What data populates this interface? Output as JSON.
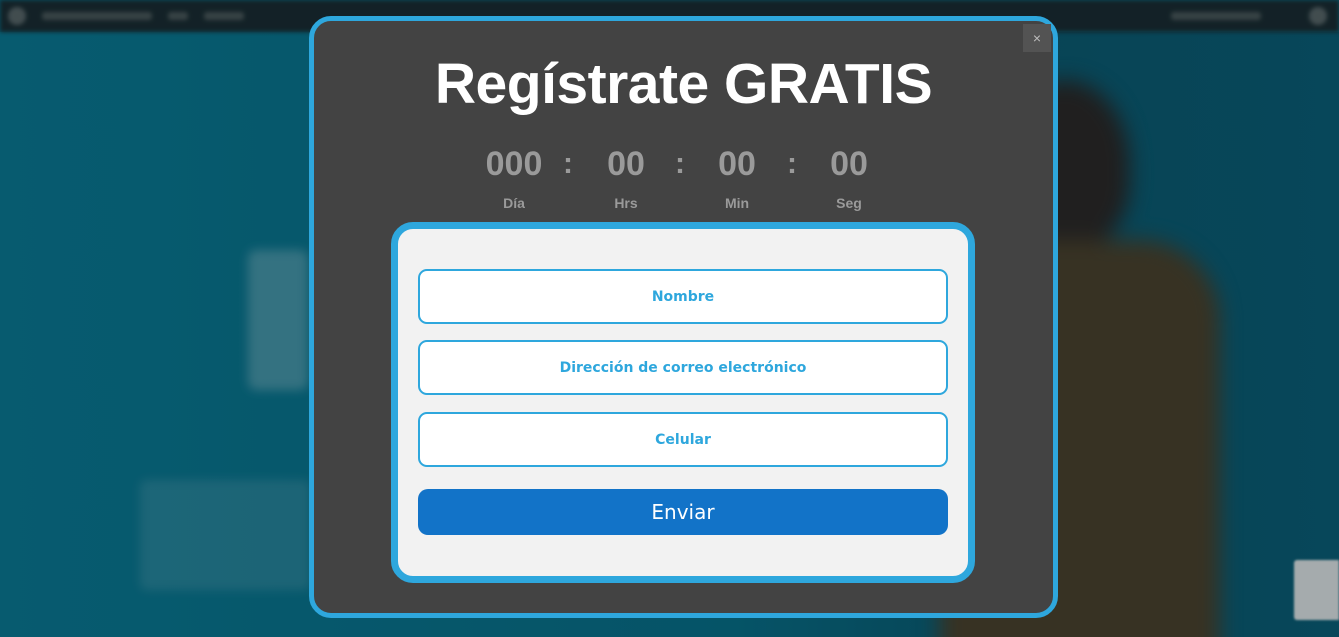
{
  "modal": {
    "close_label": "×",
    "title": "Regístrate GRATIS",
    "countdown": [
      {
        "value": "000",
        "label": "Día"
      },
      {
        "value": "00",
        "label": "Hrs"
      },
      {
        "value": "00",
        "label": "Min"
      },
      {
        "value": "00",
        "label": "Seg"
      }
    ],
    "separator": ":",
    "form": {
      "name_placeholder": "Nombre",
      "email_placeholder": "Dirección de correo electrónico",
      "phone_placeholder": "Celular",
      "submit_label": "Enviar"
    }
  },
  "colors": {
    "accent_border": "#2ea7dd",
    "modal_bg": "#434343",
    "button_bg": "#1273c8",
    "page_bg": "#0a6d86"
  }
}
